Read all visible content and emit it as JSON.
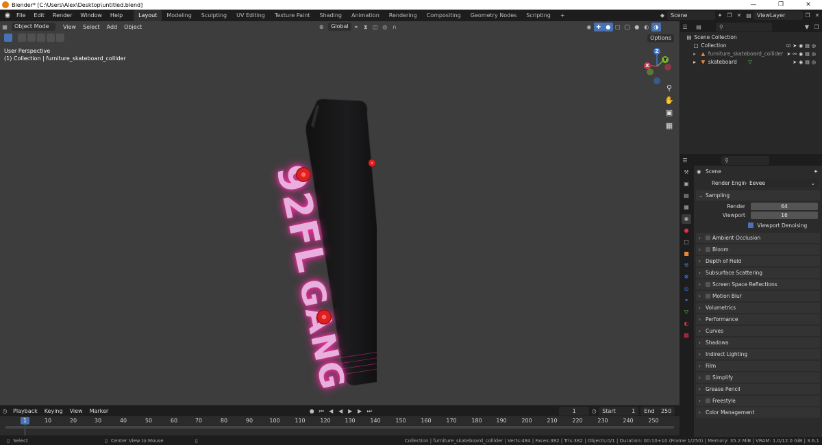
{
  "window": {
    "title": "Blender* [C:\\Users\\Alex\\Desktop\\untitled.blend]",
    "controls": [
      "—",
      "❐",
      "✕"
    ]
  },
  "menu": [
    "File",
    "Edit",
    "Render",
    "Window",
    "Help"
  ],
  "workspaces": {
    "tabs": [
      "Layout",
      "Modeling",
      "Sculpting",
      "UV Editing",
      "Texture Paint",
      "Shading",
      "Animation",
      "Rendering",
      "Compositing",
      "Geometry Nodes",
      "Scripting",
      "+"
    ],
    "active": "Layout"
  },
  "scene": {
    "name": "Scene",
    "view_layer": "ViewLayer"
  },
  "viewport": {
    "header": {
      "mode": "Object Mode",
      "menus": [
        "View",
        "Select",
        "Add",
        "Object"
      ],
      "transform": "Global"
    },
    "info_line1": "User Perspective",
    "info_line2": "(1) Collection | furniture_skateboard_collider",
    "options": "Options",
    "gizmo": {
      "z": "Z",
      "y": "Y",
      "x": "X"
    },
    "board_text": {
      "top": "92FL",
      "bottom": "GANG"
    }
  },
  "outliner": {
    "root": "Scene Collection",
    "items": [
      {
        "label": "Collection",
        "indent": 1
      },
      {
        "label": "furniture_skateboard_collider",
        "indent": 2
      },
      {
        "label": "skateboard",
        "indent": 2
      }
    ]
  },
  "properties": {
    "context": "Scene",
    "render_engine_label": "Render Engine",
    "render_engine": "Eevee",
    "sampling": {
      "title": "Sampling",
      "render_label": "Render",
      "render": "64",
      "viewport_label": "Viewport",
      "viewport": "16",
      "denoise": "Viewport Denoising"
    },
    "panels": [
      {
        "label": "Ambient Occlusion",
        "checkbox": true
      },
      {
        "label": "Bloom",
        "checkbox": true
      },
      {
        "label": "Depth of Field",
        "checkbox": false
      },
      {
        "label": "Subsurface Scattering",
        "checkbox": false
      },
      {
        "label": "Screen Space Reflections",
        "checkbox": true
      },
      {
        "label": "Motion Blur",
        "checkbox": true
      },
      {
        "label": "Volumetrics",
        "checkbox": false
      },
      {
        "label": "Performance",
        "checkbox": false
      },
      {
        "label": "Curves",
        "checkbox": false
      },
      {
        "label": "Shadows",
        "checkbox": false
      },
      {
        "label": "Indirect Lighting",
        "checkbox": false
      },
      {
        "label": "Film",
        "checkbox": false
      },
      {
        "label": "Simplify",
        "checkbox": true
      },
      {
        "label": "Grease Pencil",
        "checkbox": false
      },
      {
        "label": "Freestyle",
        "checkbox": true
      },
      {
        "label": "Color Management",
        "checkbox": false
      }
    ]
  },
  "timeline": {
    "menus": [
      "Playback",
      "Keying",
      "View",
      "Marker"
    ],
    "current_frame": "1",
    "start_label": "Start",
    "start": "1",
    "end_label": "End",
    "end": "250",
    "ticks": [
      "1",
      "10",
      "20",
      "30",
      "40",
      "50",
      "60",
      "70",
      "80",
      "90",
      "100",
      "110",
      "120",
      "130",
      "140",
      "150",
      "160",
      "170",
      "180",
      "190",
      "200",
      "210",
      "220",
      "230",
      "240",
      "250"
    ]
  },
  "statusbar": {
    "select": "Select",
    "center": "Center View to Mouse",
    "stats": "Collection | furniture_skateboard_collider | Verts:484 | Faces:382 | Tris:382 | Objects:0/1 | Duration: 00:10+10 (Frame 1/250) | Memory: 35.2 MiB | VRAM: 1.0/12.0 GiB | 3.6.1"
  },
  "colors": {
    "accent": "#4772b3",
    "viewport_bg": "#3d3d3d",
    "board_text": "#e8b0dc",
    "board_glow": "#ff2fa8",
    "wheel": "#e02020"
  }
}
